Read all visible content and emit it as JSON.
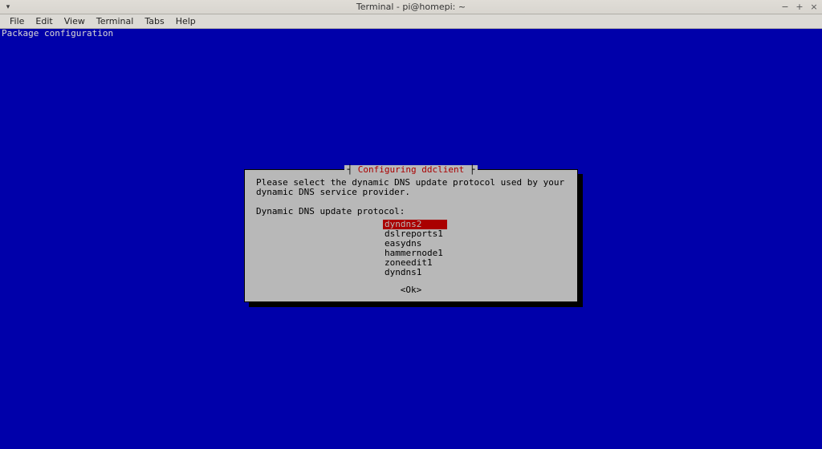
{
  "window": {
    "title": "Terminal - pi@homepi: ~",
    "controls": {
      "min": "−",
      "max": "+",
      "close": "×"
    }
  },
  "menu": {
    "items": [
      "File",
      "Edit",
      "View",
      "Terminal",
      "Tabs",
      "Help"
    ]
  },
  "terminal": {
    "header": "Package configuration"
  },
  "dialog": {
    "title": "Configuring ddclient",
    "prompt": "Please select the dynamic DNS update protocol used by your dynamic DNS service provider.",
    "label": "Dynamic DNS update protocol:",
    "options": [
      {
        "name": "dyndns2",
        "selected": true
      },
      {
        "name": "dslreports1",
        "selected": false
      },
      {
        "name": "easydns",
        "selected": false
      },
      {
        "name": "hammernode1",
        "selected": false
      },
      {
        "name": "zoneedit1",
        "selected": false
      },
      {
        "name": "dyndns1",
        "selected": false
      }
    ],
    "ok": "<Ok>"
  }
}
